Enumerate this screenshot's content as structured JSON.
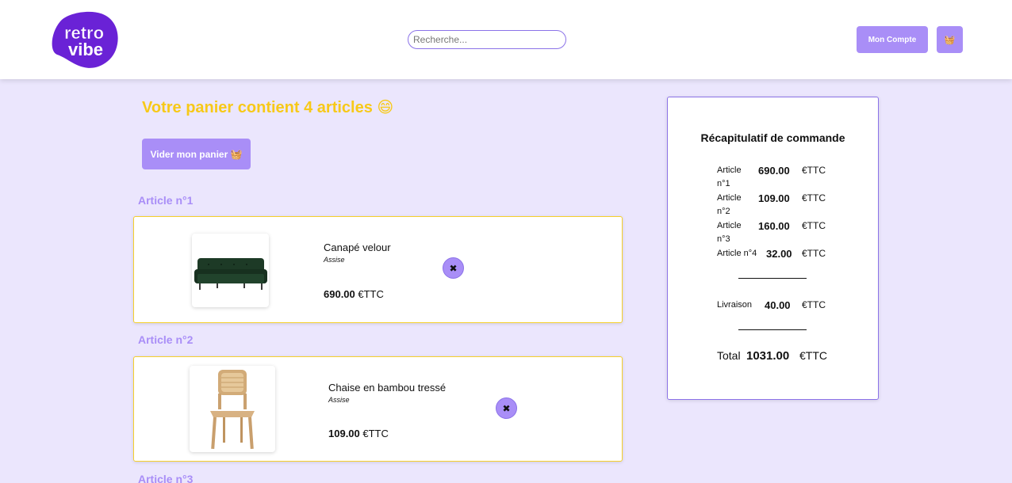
{
  "header": {
    "logo_text_line1": "retro",
    "logo_text_line2": "vibe",
    "search_placeholder": "Recherche...",
    "account_label": "Mon Compte",
    "cart_icon": "basket-icon"
  },
  "cart": {
    "title": "Votre panier contient 4 articles 😄",
    "empty_label": "Vider mon panier 🧺",
    "items": [
      {
        "label": "Article n°1",
        "name": "Canapé velour",
        "category": "Assise",
        "price": "690.00",
        "currency": "€TTC",
        "remove": "✖"
      },
      {
        "label": "Article n°2",
        "name": "Chaise en bambou tressé",
        "category": "Assise",
        "price": "109.00",
        "currency": "€TTC",
        "remove": "✖"
      },
      {
        "label": "Article n°3"
      }
    ]
  },
  "summary": {
    "title": "Récapitulatif de commande",
    "rows": [
      {
        "label": "Article n°1",
        "value": "690.00",
        "currency": "€TTC"
      },
      {
        "label": "Article n°2",
        "value": "109.00",
        "currency": "€TTC"
      },
      {
        "label": "Article n°3",
        "value": "160.00",
        "currency": "€TTC"
      },
      {
        "label": "Article n°4",
        "value": "32.00",
        "currency": "€TTC"
      }
    ],
    "delivery": {
      "label": "Livraison",
      "value": "40.00",
      "currency": "€TTC"
    },
    "total": {
      "label": "Total",
      "value": "1031.00",
      "currency": "€TTC"
    }
  },
  "colors": {
    "accent": "#a98ef7",
    "title_yellow": "#f7c918",
    "background": "#ebe6fd"
  }
}
